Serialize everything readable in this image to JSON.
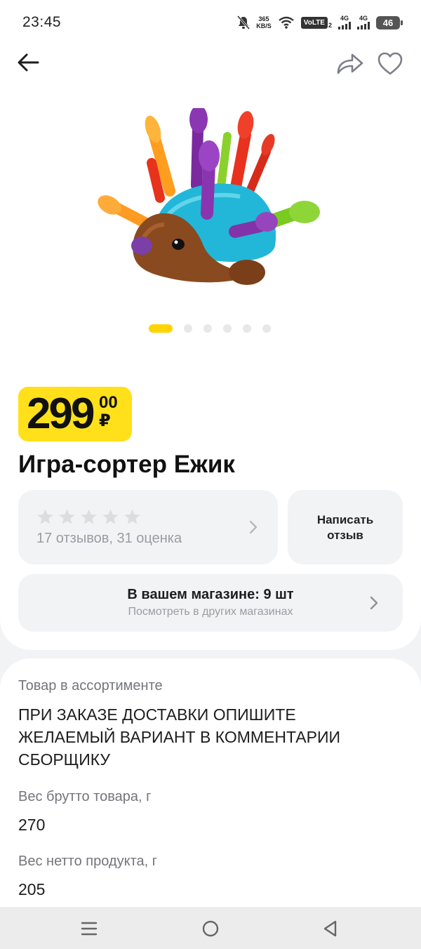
{
  "status_bar": {
    "time": "23:45",
    "net_speed_value": "365",
    "net_speed_unit": "KB/S",
    "volte": "VoLTE",
    "volte_sub": "2",
    "sig1_label": "4G",
    "sig2_label": "4G",
    "battery": "46",
    "icons": [
      "bell-off-icon",
      "wifi-icon",
      "signal-icon",
      "battery-icon"
    ]
  },
  "header": {
    "icons": [
      "arrow-left-icon",
      "share-icon",
      "heart-icon"
    ]
  },
  "gallery": {
    "image_subject": "hedgehog-sorter-toy",
    "total_slides": 6,
    "active_slide": 1,
    "accent_color": "#ffd400"
  },
  "price": {
    "main": "299",
    "kopecks": "00",
    "currency": "₽",
    "badge_color": "#ffe01b"
  },
  "product": {
    "title": "Игра-сортер Ежик"
  },
  "rating": {
    "stars_filled": 0,
    "stars_total": 5,
    "summary": "17 отзывов, 31 оценка"
  },
  "review_button": {
    "line1": "Написать",
    "line2": "отзыв"
  },
  "stock": {
    "title": "В вашем магазине: 9 шт",
    "subtitle": "Посмотреть в других магазинах"
  },
  "info": {
    "availability": "Товар в ассортименте",
    "note": "ПРИ ЗАКАЗЕ ДОСТАВКИ ОПИШИТЕ ЖЕЛАЕМЫЙ ВАРИАНТ В КОММЕНТАРИИ СБОРЩИКУ",
    "gross_weight_label": "Вес брутто товара, г",
    "gross_weight_value": "270",
    "net_weight_label": "Вес нетто продукта, г",
    "net_weight_value": "205"
  },
  "system_nav": {
    "icons": [
      "menu-icon",
      "home-circle-icon",
      "back-triangle-icon"
    ]
  }
}
